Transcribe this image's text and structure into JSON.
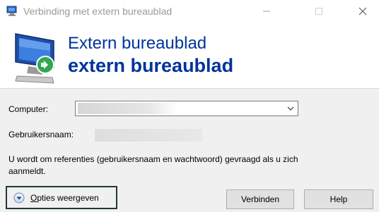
{
  "window": {
    "title": "Verbinding met extern bureaublad",
    "app_icon": "remote-desktop-icon",
    "controls": [
      "minimize-icon",
      "maximize-icon",
      "close-icon"
    ]
  },
  "header": {
    "line1": "Extern bureaublad",
    "line2": "extern bureaublad",
    "icon": "remote-desktop-monitor-icon",
    "text_color": "#003399"
  },
  "form": {
    "computer_label": "Computer:",
    "computer_value": "",
    "username_label": "Gebruikersnaam:",
    "username_value": ""
  },
  "info": {
    "text": "U wordt om referenties (gebruikersnaam en wachtwoord) gevraagd als u zich aanmeldt."
  },
  "options": {
    "label_first": "O",
    "label_rest": "pties weergeven",
    "icon": "chevron-down-circle-icon"
  },
  "buttons": {
    "connect": "Verbinden",
    "help": "Help"
  }
}
